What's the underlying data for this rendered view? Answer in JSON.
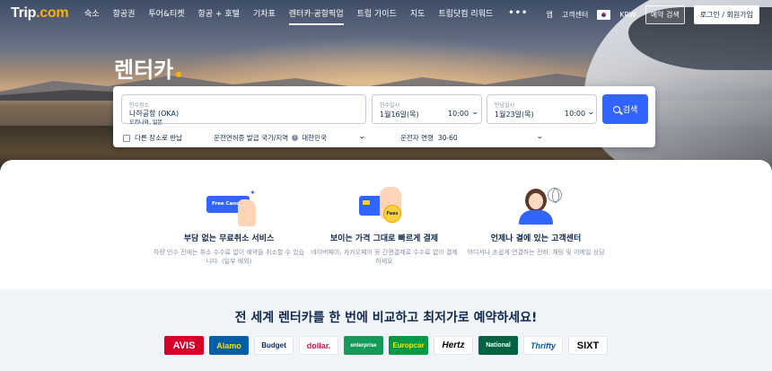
{
  "logo": {
    "text": "Trip",
    "suffix": ".com"
  },
  "nav": {
    "items": [
      "숙소",
      "항공권",
      "투어&티켓",
      "항공 + 호텔",
      "기차표",
      "렌터카·공항픽업",
      "트립 가이드",
      "지도",
      "트립닷컴 리워드"
    ],
    "active_index": 5,
    "more": "•••",
    "app": "앱",
    "support": "고객센터",
    "currency": "KRW",
    "bookings": "예약 검색",
    "login": "로그인 / 회원가입"
  },
  "hero": {
    "title": "렌터카"
  },
  "search": {
    "pickup_location": {
      "label": "인수장소",
      "value": "나하공항 (OKA)",
      "sub": "오키나와, 일본"
    },
    "pickup_date": {
      "label": "인수일시",
      "date": "1월16일(목)",
      "time": "10:00"
    },
    "return_date": {
      "label": "반납일시",
      "date": "1월23일(목)",
      "time": "10:00"
    },
    "search_label": "검색",
    "different_return": "다른 장소로 반납",
    "license_label": "운전면허증 발급 국가/지역",
    "license_value": "대한민국",
    "driver_age_label": "운전자 연령",
    "driver_age_value": "30-60"
  },
  "features": [
    {
      "icon_text": "Free Cancel",
      "title": "부담 없는 무료취소 서비스",
      "desc": "차량 인수 전에는 취소 수수료 없이 예약을 취소할 수 있습니다. (일부 예외)"
    },
    {
      "icon_text": "Fees",
      "title": "보이는 가격 그대로 빠르게 결제",
      "desc": "네이버페이, 카카오페이 등 간편결제로 수수료 없이 결제하세요"
    },
    {
      "title": "언제나 곁에 있는 고객센터",
      "desc": "어디서나 손쉽게 연결하는 전화, 채팅 및 이메일 상담"
    }
  ],
  "bottom": {
    "title": "전 세계 렌터카를 한 번에 비교하고 최저가로 예약하세요!",
    "brands": [
      {
        "name": "AVIS",
        "bg": "#d4002a",
        "fg": "#ffffff"
      },
      {
        "name": "Alamo",
        "bg": "#005daa",
        "fg": "#ffde00"
      },
      {
        "name": "Budget",
        "bg": "#ffffff",
        "fg": "#00285f"
      },
      {
        "name": "dollar.",
        "bg": "#ffffff",
        "fg": "#d31145"
      },
      {
        "name": "enterprise",
        "bg": "#169a5a",
        "fg": "#ffffff"
      },
      {
        "name": "Europcar",
        "bg": "#009a44",
        "fg": "#ffe500"
      },
      {
        "name": "Hertz",
        "bg": "#ffffff",
        "fg": "#000000"
      },
      {
        "name": "National",
        "bg": "#006341",
        "fg": "#ffffff"
      },
      {
        "name": "Thrifty",
        "bg": "#ffffff",
        "fg": "#0057a8"
      },
      {
        "name": "SIXT",
        "bg": "#ffffff",
        "fg": "#000000"
      }
    ]
  },
  "colors": {
    "primary": "#3264ff",
    "text": "#0f294d",
    "muted": "#8592a6",
    "accent": "#ffb100"
  }
}
